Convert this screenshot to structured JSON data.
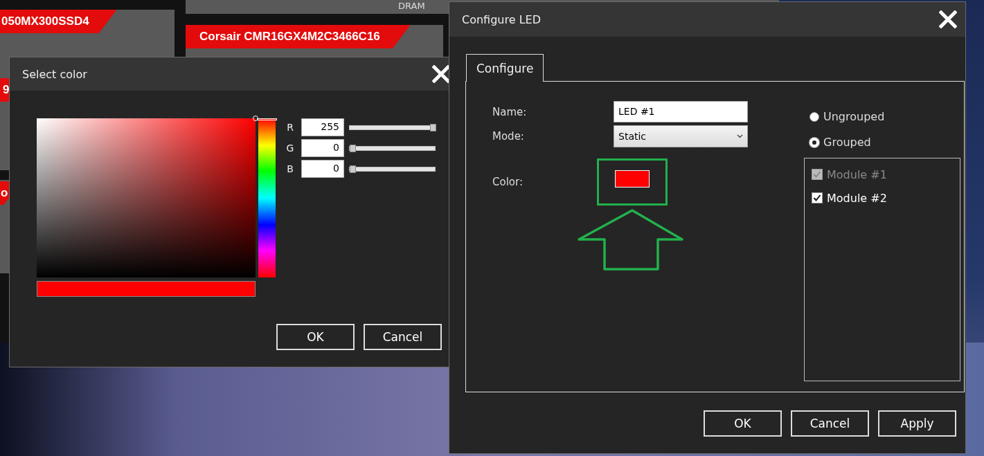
{
  "background_app": {
    "tags": [
      {
        "text": "050MX300SSD4"
      },
      {
        "text": "Corsair CMR16GX4M2C3466C16"
      },
      {
        "text": "9"
      },
      {
        "text": "o"
      }
    ],
    "card_caption": "DRAM"
  },
  "select_color_dialog": {
    "title": "Select color",
    "channels": [
      {
        "label": "R",
        "value": "255",
        "level": 1
      },
      {
        "label": "G",
        "value": "0",
        "level": 0
      },
      {
        "label": "B",
        "value": "0",
        "level": 0
      }
    ],
    "hue": {
      "level": 0
    },
    "buttons": [
      "OK",
      "Cancel"
    ]
  },
  "configure_led_dialog": {
    "title": "Configure LED",
    "tabs": [
      {
        "label": "Configure",
        "selected": true
      }
    ],
    "name": {
      "label": "Name:",
      "value": "LED #1"
    },
    "mode": {
      "label": "Mode:",
      "value": "Static"
    },
    "color": {
      "label": "Color:"
    },
    "grouping": [
      {
        "label": "Ungrouped",
        "selected": false
      },
      {
        "label": "Grouped",
        "selected": true
      }
    ],
    "modules": [
      {
        "label": "Module #1",
        "checked": true,
        "disabled": true
      },
      {
        "label": "Module #2",
        "checked": true,
        "disabled": false
      }
    ],
    "buttons": [
      "OK",
      "Cancel",
      "Apply"
    ]
  }
}
